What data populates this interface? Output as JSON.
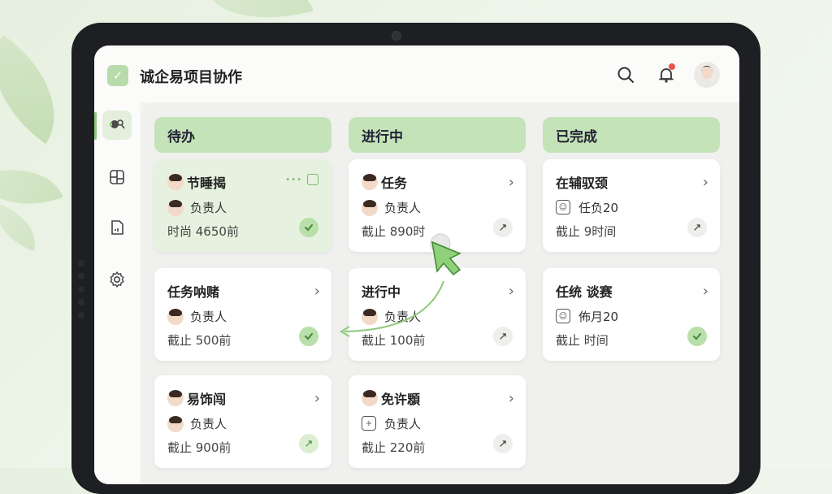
{
  "app": {
    "title": "诚企易项目协作",
    "logo_icon": "check-icon",
    "accent": "#8fc97c",
    "column_header_color": "#c5e3b8"
  },
  "header": {
    "icons": [
      "search-icon",
      "bell-icon",
      "avatar"
    ]
  },
  "sidebar": {
    "items": [
      "people-icon",
      "board-icon",
      "document-icon",
      "gear-icon"
    ]
  },
  "columns": [
    {
      "title": "待办",
      "cards": [
        {
          "title": "节睡揭",
          "owner": "负责人",
          "deadline": "时尚 4650前"
        },
        {
          "title": "任务呐赌",
          "owner": "负责人",
          "deadline": "截止 500前"
        },
        {
          "title": "易饰闯",
          "owner": "负责人",
          "deadline": "截止 900前"
        }
      ]
    },
    {
      "title": "进行中",
      "cards": [
        {
          "title": "任务",
          "owner": "负责人",
          "deadline": "截止 890时"
        },
        {
          "title": "进行中",
          "owner": "负责人",
          "deadline": "截止 100前"
        },
        {
          "title": "免许顋",
          "owner": "负责人",
          "deadline": "截止 220前"
        }
      ]
    },
    {
      "title": "已完成",
      "cards": [
        {
          "title": "在辅驭颈",
          "owner": "任负20",
          "deadline": "截止 9时间"
        },
        {
          "title": "任统 谈赛",
          "owner": "佈月20",
          "deadline": "截止 时间"
        }
      ]
    }
  ]
}
